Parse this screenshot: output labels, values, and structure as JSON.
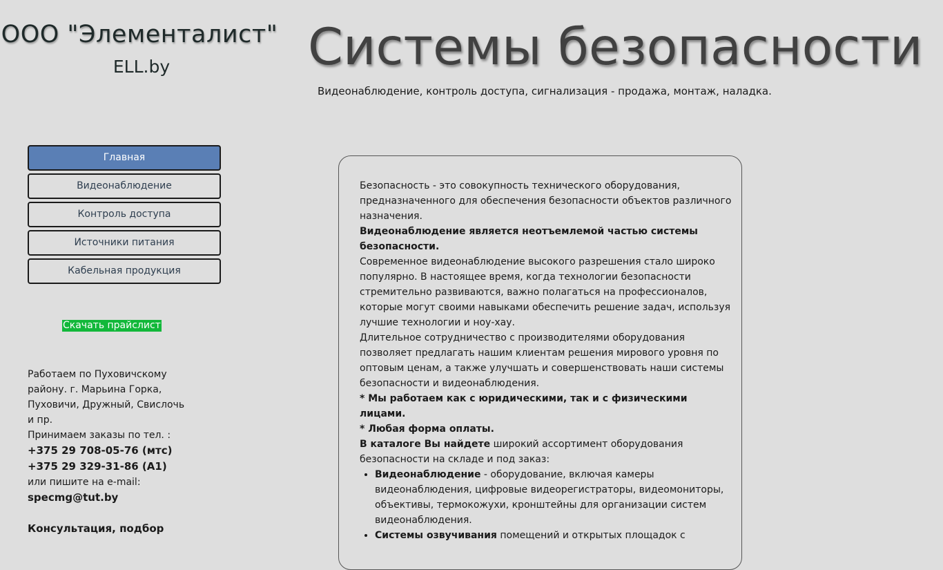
{
  "header": {
    "company_name": "ООО \"Элементалист\"",
    "domain": "ELL.by",
    "title": "Системы безопасности",
    "tagline": "Видеонаблюдение, контроль доступа, сигнализация - продажа, монтаж, наладка."
  },
  "nav": {
    "items": [
      {
        "label": "Главная",
        "active": true
      },
      {
        "label": "Видеонаблюдение",
        "active": false
      },
      {
        "label": "Контроль доступа",
        "active": false
      },
      {
        "label": "Источники питания",
        "active": false
      },
      {
        "label": "Кабельная продукция",
        "active": false
      }
    ]
  },
  "download_link": "Скачать прайслист",
  "contacts": {
    "region": "Работаем по Пуховичскому району. г. Марьина Горка, Пуховичи, Дружный, Свислочь и пр.",
    "phone_intro": "Принимаем заказы по тел. :",
    "phone1": "+375 29 708-05-76 (мтс)",
    "phone2": "+375 29 329-31-86 (А1)",
    "email_intro": "или пишите на e-mail:",
    "email": "specmg@tut.by",
    "consult": "Консультация, подбор"
  },
  "content": {
    "p1": "Безопасность - это совокупность технического  оборудования, предназначенного для обеспечения безопасности объектов различного  назначения.",
    "p2_bold": "Видеонаблюдение является неотъемлемой  частью системы безопасности.",
    "p3": "Современное видеонаблюдение высокого разрешения  стало широко популярно. В настоящее время, когда технологии безопасности  стремительно развиваются, важно полагаться на профессионалов, которые могут  своими навыками обеспечить решение задач, используя лучшие технологии и  ноу-хау.",
    "p4": "Длительное сотрудничество с производителями  оборудования позволяет предлагать нашим клиентам решения мирового уровня по  оптовым ценам, а также улучшать и совершенствовать наши системы безопасности и  видеонаблюдения.",
    "p5_bold": "* Мы работаем как с юридическими, так и с физическими лицами.",
    "p6_bold": "* Любая  форма оплаты.",
    "p7_bold": "В каталоге Вы найдете",
    "p7_rest": " широкий ассортимент оборудования  безопасности на складе и под заказ:",
    "list": [
      {
        "bold": "Видеонаблюдение",
        "text": " -  оборудование, включая камеры видеонаблюдения, цифровые  видеорегистраторы, видеомониторы, объективы, термокожухи, кронштейны для  организации систем видеонаблюдения."
      },
      {
        "bold": "Системы  озвучивания",
        "text": " помещений и открытых площадок с"
      }
    ]
  }
}
